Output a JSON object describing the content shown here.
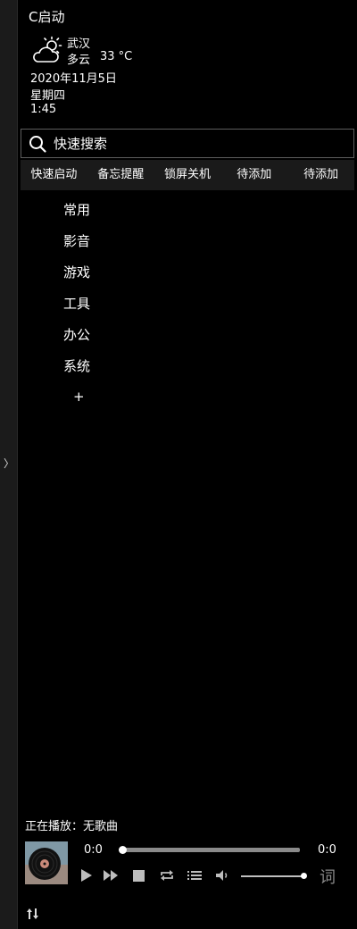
{
  "app": {
    "title": "C启动"
  },
  "sidebar": {
    "toggle_glyph": "〉"
  },
  "weather": {
    "icon": "partly-cloudy-icon",
    "city": "武汉",
    "condition": "多云",
    "temperature": "33 °C",
    "date": "2020年11月5日",
    "weekday": "星期四",
    "time": "1:45"
  },
  "search": {
    "placeholder": "快速搜索",
    "icon": "search-icon"
  },
  "tabs": [
    {
      "label": "快速启动"
    },
    {
      "label": "备忘提醒"
    },
    {
      "label": "锁屏关机"
    },
    {
      "label": "待添加"
    },
    {
      "label": "待添加"
    }
  ],
  "categories": [
    {
      "label": "常用"
    },
    {
      "label": "影音"
    },
    {
      "label": "游戏"
    },
    {
      "label": "工具"
    },
    {
      "label": "办公"
    },
    {
      "label": "系统"
    }
  ],
  "add_category": {
    "label": "+"
  },
  "player": {
    "now_playing": "正在播放：无歌曲",
    "current_time": "0:0",
    "total_time": "0:0",
    "progress": 0,
    "volume": 1.0,
    "lyrics_label": "词",
    "controls": [
      "play-icon",
      "fast-forward-icon",
      "stop-icon",
      "repeat-icon",
      "playlist-icon",
      "volume-icon"
    ]
  },
  "colors": {
    "background": "#000000",
    "rail": "#1b1b1b",
    "tab_bar": "#1a1a1a",
    "text": "#ffffff",
    "muted": "#8a8a8a"
  }
}
